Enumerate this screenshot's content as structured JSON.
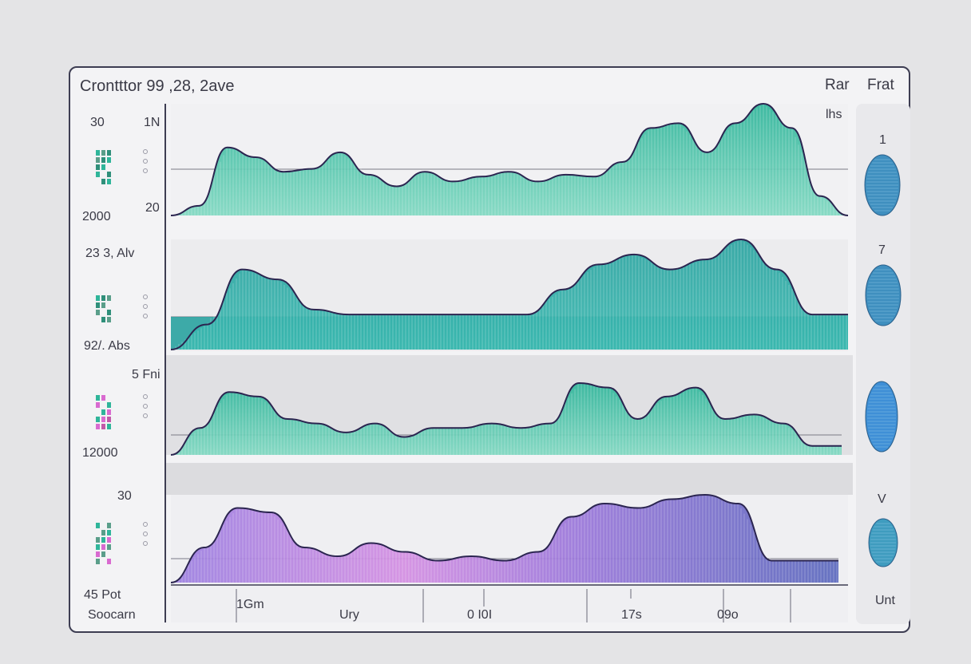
{
  "header": {
    "title": "Crontttor 99 ,28, 2ave",
    "right_labels": [
      "Rar",
      "Frat"
    ],
    "sub_right": "lhs"
  },
  "left_labels": [
    "30",
    "2000",
    "23 3, Alv",
    "92/. Abs",
    "5 Fni",
    "12000",
    "30",
    "45 Pot",
    "Soocarn"
  ],
  "axis_ticks": [
    "1N",
    "20"
  ],
  "x_ticks": [
    "1Gm",
    "Ury",
    "0 I0I",
    "17s",
    "09o"
  ],
  "right_panel": {
    "labels": [
      "1",
      "7",
      "V",
      "Unt"
    ],
    "colors": [
      "#3f8fbf",
      "#3f8fbf",
      "#3f8fd6",
      "#3f9cbf"
    ]
  },
  "colors": {
    "teal": "#2fb59a",
    "teal_light": "#7fd8c1",
    "blue_purple": "#5a68bd",
    "pink": "#e58adf",
    "outline": "#2b2550",
    "frame": "#3d3d52"
  },
  "chart_data": [
    {
      "type": "area",
      "series": [
        {
          "values": [
            0,
            10,
            70,
            60,
            45,
            48,
            65,
            42,
            30,
            45,
            35,
            40,
            45,
            35,
            42,
            40,
            55,
            90,
            95,
            65,
            95,
            115,
            90,
            20,
            0
          ]
        }
      ]
    },
    {
      "type": "area",
      "series": [
        {
          "values": [
            0,
            25,
            80,
            70,
            40,
            35,
            35,
            35,
            35,
            35,
            35,
            60,
            85,
            95,
            80,
            90,
            110,
            80,
            35,
            35
          ]
        }
      ]
    },
    {
      "type": "area",
      "series": [
        {
          "values": [
            0,
            30,
            70,
            65,
            40,
            35,
            25,
            35,
            20,
            30,
            30,
            35,
            30,
            35,
            80,
            75,
            40,
            65,
            75,
            40,
            45,
            35,
            10,
            10
          ]
        }
      ]
    },
    {
      "type": "area",
      "series": [
        {
          "values": [
            0,
            40,
            85,
            80,
            40,
            30,
            45,
            35,
            25,
            30,
            25,
            35,
            75,
            90,
            85,
            95,
            100,
            90,
            25,
            25,
            25
          ]
        }
      ]
    }
  ]
}
